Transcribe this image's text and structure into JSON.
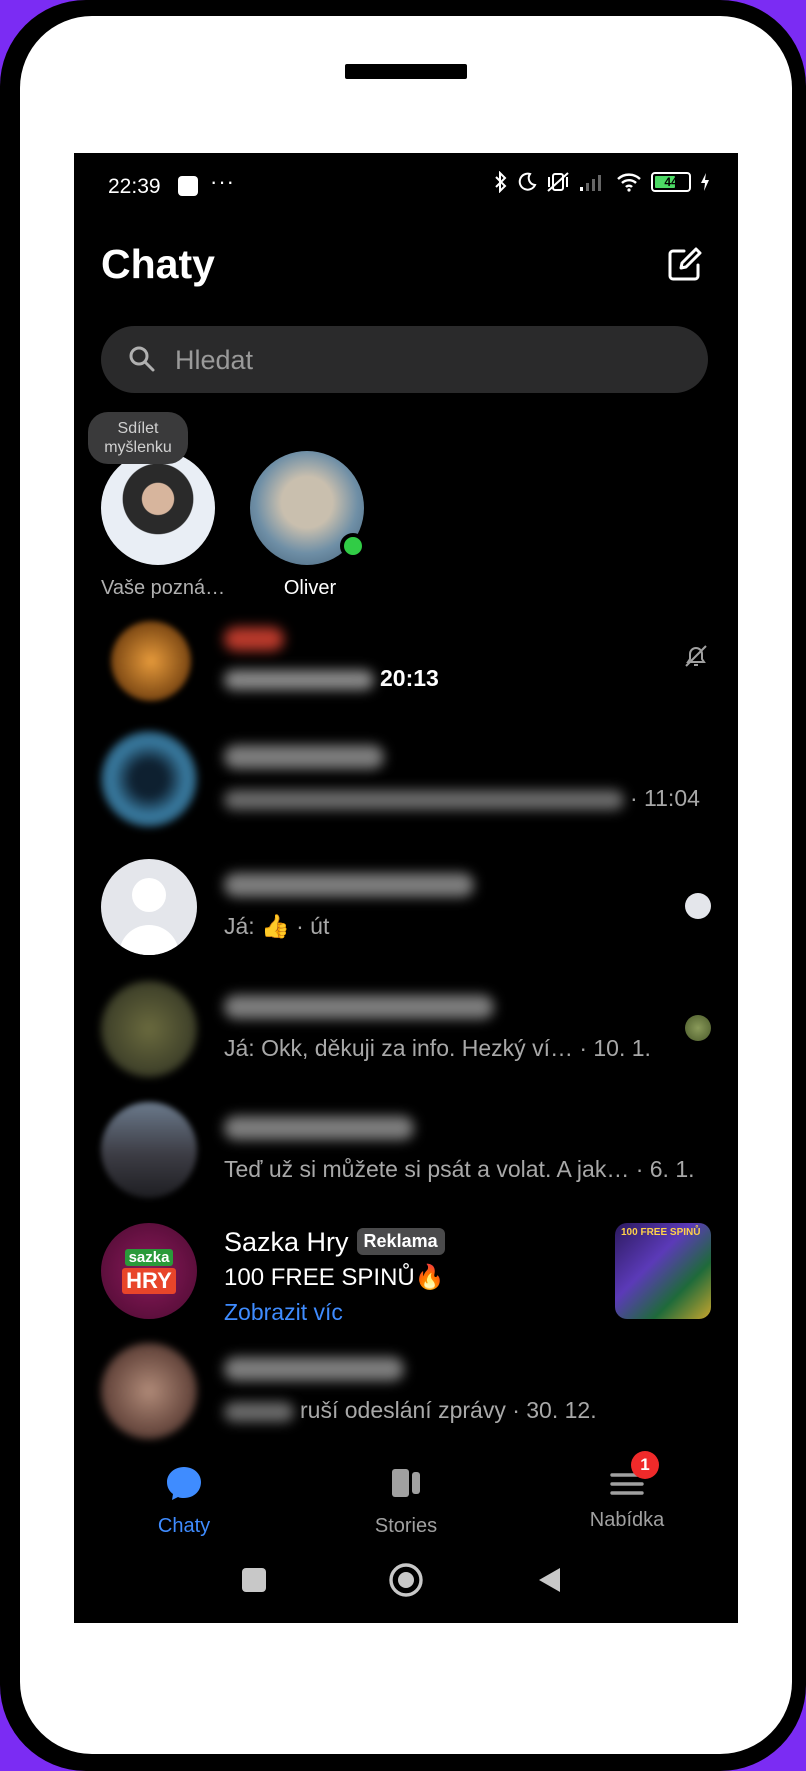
{
  "status_bar": {
    "time": "22:39",
    "dots": "···",
    "battery": "44",
    "icons": [
      "bluetooth-icon",
      "moon-icon",
      "vibrate-off-icon",
      "signal-icon",
      "wifi-icon",
      "battery-icon",
      "charging-icon"
    ]
  },
  "header": {
    "title": "Chaty",
    "compose_icon": "compose-icon"
  },
  "search": {
    "placeholder": "Hledat"
  },
  "stories": {
    "bubble": "Sdílet myšlenku",
    "items": [
      {
        "label": "Vaše pozná…"
      },
      {
        "label": "Oliver",
        "online": true
      }
    ]
  },
  "chats": [
    {
      "time": "20:13",
      "muted": true,
      "unread": true
    },
    {
      "time": "· 11:04"
    },
    {
      "message_prefix": "Já: ",
      "emoji": "👍",
      "time": "· út"
    },
    {
      "message": "Já: Okk, děkuji za info. Hezký ví…",
      "time": "· 10. 1."
    },
    {
      "message": "Teď už si můžete si psát a volat. A jak…",
      "time": "· 6. 1."
    },
    {
      "message": "ruší odeslání zprávy",
      "time": "· 30. 12."
    }
  ],
  "ad": {
    "name": "Sazka Hry",
    "badge": "Reklama",
    "text": "100 FREE SPINŮ",
    "emoji": "🔥",
    "link": "Zobrazit víc",
    "logo_top": "sazka",
    "logo_bottom": "HRY",
    "thumb_text": "100 FREE SPINŮ"
  },
  "tabs": [
    {
      "label": "Chaty",
      "active": true
    },
    {
      "label": "Stories"
    },
    {
      "label": "Nabídka",
      "badge": "1"
    }
  ],
  "colors": {
    "accent": "#3f8cff",
    "online": "#31cc46",
    "badge": "#f02a2a",
    "frame": "#7b2cf3"
  }
}
